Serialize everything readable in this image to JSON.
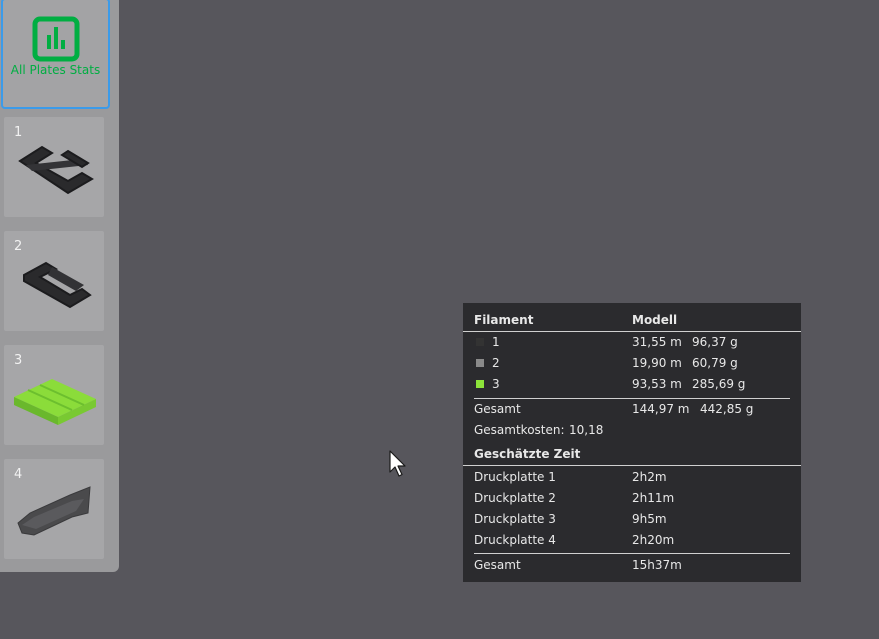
{
  "sidebar": {
    "stats_label": "All Plates Stats",
    "stats_icon": "bar-chart-icon",
    "accent": "#00ae42",
    "selection_color": "#3b9bea",
    "plates": [
      {
        "number": "1",
        "color": "#2a2a2c"
      },
      {
        "number": "2",
        "color": "#2a2a2c"
      },
      {
        "number": "3",
        "color": "#8bdc3a"
      },
      {
        "number": "4",
        "color": "#4a4a4c"
      }
    ]
  },
  "stats": {
    "filament_header": "Filament",
    "model_header": "Modell",
    "filaments": [
      {
        "id": "1",
        "length": "31,55 m",
        "weight": "96,37 g",
        "color": "#333333"
      },
      {
        "id": "2",
        "length": "19,90 m",
        "weight": "60,79 g",
        "color": "#8a8a8a"
      },
      {
        "id": "3",
        "length": "93,53 m",
        "weight": "285,69 g",
        "color": "#8de33a"
      }
    ],
    "total_label": "Gesamt",
    "total_length": "144,97 m",
    "total_weight": "442,85 g",
    "cost_label": "Gesamtkosten:",
    "cost_value": "10,18",
    "time_header": "Geschätzte Zeit",
    "plates": [
      {
        "label": "Druckplatte 1",
        "time": "2h2m"
      },
      {
        "label": "Druckplatte 2",
        "time": "2h11m"
      },
      {
        "label": "Druckplatte 3",
        "time": "9h5m"
      },
      {
        "label": "Druckplatte 4",
        "time": "2h20m"
      }
    ],
    "time_total_label": "Gesamt",
    "time_total": "15h37m"
  }
}
